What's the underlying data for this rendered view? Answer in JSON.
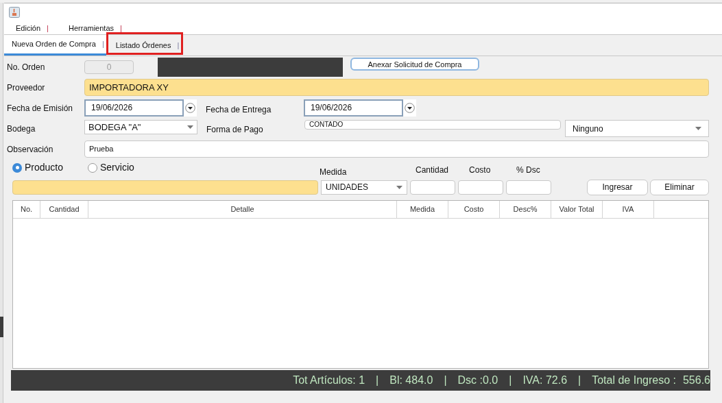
{
  "menu": [
    {
      "label": "Edición",
      "separator": "|"
    },
    {
      "label": "Herramientas",
      "separator": "|"
    }
  ],
  "tabs": [
    {
      "label": "Nueva Orden de Compra",
      "separator": "|",
      "selected": true,
      "highlighted": false
    },
    {
      "label": "Listado Órdenes",
      "separator": "|",
      "selected": false,
      "highlighted": true
    }
  ],
  "form": {
    "order_number": {
      "label": "No. Orden",
      "value": "0",
      "disabled": true
    },
    "attach_button": "Anexar Solicitud de Compra",
    "supplier": {
      "label": "Proveedor",
      "value": "IMPORTADORA XY"
    },
    "issue_date": {
      "label": "Fecha de Emisión",
      "value": "19/06/2026"
    },
    "delivery_date": {
      "label": "Fecha de Entrega",
      "value": "19/06/2026"
    },
    "warehouse": {
      "label": "Bodega",
      "value": "BODEGA \"A\""
    },
    "payment": {
      "label": "Forma de Pago",
      "value": "CONTADO",
      "option": "Ninguno"
    },
    "observation": {
      "label": "Observación",
      "value": "Prueba"
    }
  },
  "item_type": [
    {
      "label": "Producto",
      "selected": true
    },
    {
      "label": "Servicio",
      "selected": false
    }
  ],
  "item_entry": {
    "unit_label": "Medida",
    "quantity_label": "Cantidad",
    "cost_label": "Costo",
    "discount_label": "% Dsc",
    "unit": "UNIDADES"
  },
  "buttons": [
    "Ingresar",
    "Eliminar"
  ],
  "table": {
    "columns": [
      "No.",
      "Cantidad",
      "Detalle",
      "Medida",
      "Costo",
      "Desc%",
      "Valor Total",
      "IVA"
    ]
  },
  "status_bar": [
    {
      "kind": "text",
      "text": "Tot Artículos: 1"
    },
    {
      "kind": "separator",
      "text": "|"
    },
    {
      "kind": "text",
      "text": "Bl: 484.0"
    },
    {
      "kind": "separator",
      "text": "|"
    },
    {
      "kind": "text",
      "text": "Dsc :0.0"
    },
    {
      "kind": "separator",
      "text": "|"
    },
    {
      "kind": "text",
      "text": "IVA: 72.6"
    },
    {
      "kind": "separator",
      "text": "|"
    },
    {
      "kind": "text",
      "text": "Total de Ingreso :"
    },
    {
      "kind": "value",
      "text": "556.6"
    }
  ]
}
